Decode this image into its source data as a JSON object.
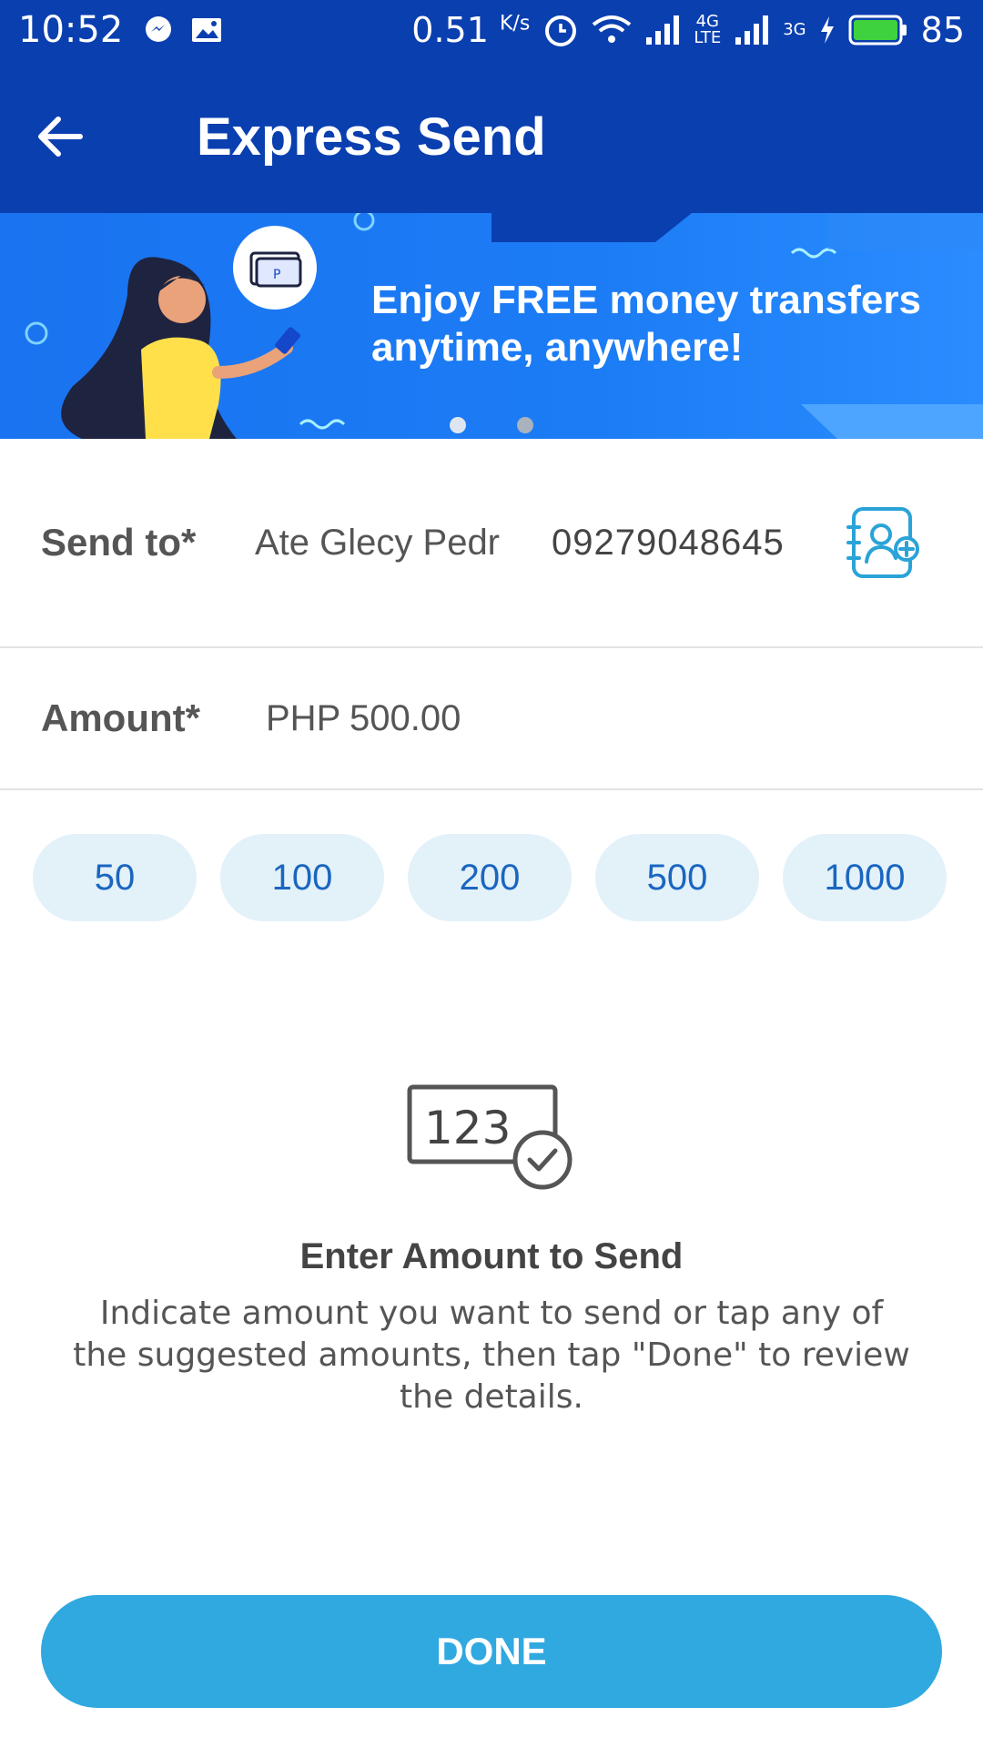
{
  "status_bar": {
    "time": "10:52",
    "net_speed": "0.51",
    "net_unit": "K/s",
    "net_4g": "4G",
    "net_lte": "LTE",
    "net_3g": "3G",
    "battery": "85",
    "icons": [
      "messenger-icon",
      "gallery-icon",
      "alarm-icon",
      "wifi-icon",
      "signal-icon",
      "signal-icon",
      "charging-icon",
      "battery-icon"
    ]
  },
  "app_bar": {
    "title": "Express Send",
    "back_icon": "arrow-left-icon"
  },
  "banner": {
    "line1": "Enjoy FREE money transfers",
    "line2": "anytime, anywhere!",
    "slides": 2,
    "active_slide": 1
  },
  "send_to": {
    "label": "Send to*",
    "name": "Ate Glecy Pedr",
    "number": "09279048645",
    "contact_icon": "contacts-add-icon"
  },
  "amount": {
    "label": "Amount*",
    "currency": "PHP",
    "value": "500.00"
  },
  "suggested_amounts": [
    "50",
    "100",
    "200",
    "500",
    "1000"
  ],
  "info": {
    "icon_text": "123",
    "title": "Enter Amount to Send",
    "description": "Indicate amount you want to send or tap any of the suggested amounts, then tap \"Done\" to review the details."
  },
  "done_label": "DONE",
  "colors": {
    "primary_dark": "#0a3fb0",
    "banner_blue": "#1b7cf5",
    "chip_bg": "#e3f1f9",
    "chip_text": "#1a66c0",
    "done_bg": "#30a8e0",
    "contact_icon": "#2aa3d8"
  }
}
